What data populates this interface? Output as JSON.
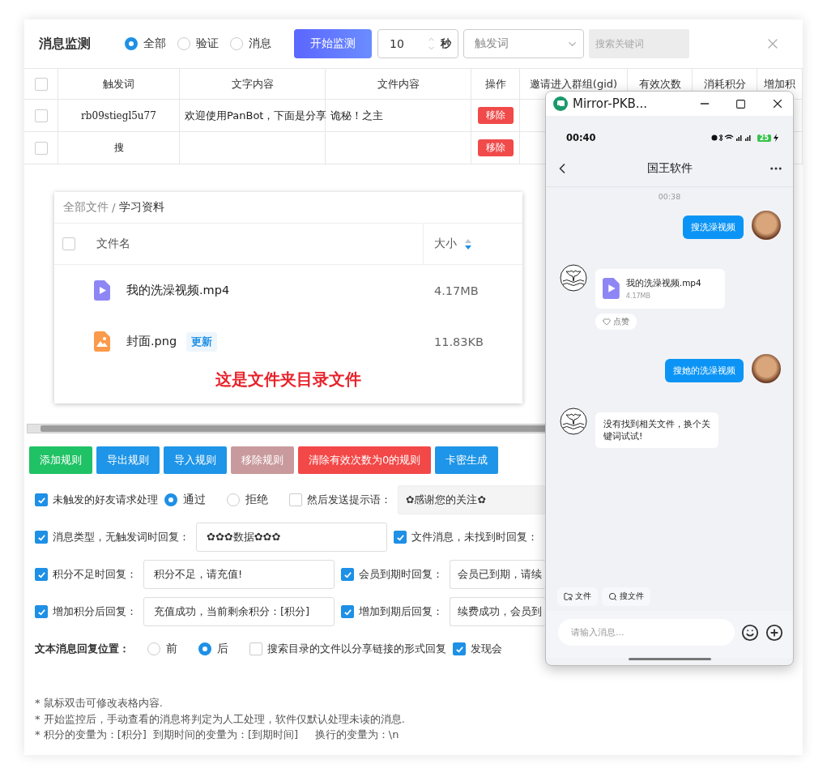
{
  "title": "消息监测",
  "filter": [
    {
      "label": "全部",
      "selected": true
    },
    {
      "label": "验证",
      "selected": false
    },
    {
      "label": "消息",
      "selected": false
    }
  ],
  "start_button": "开始监测",
  "interval": {
    "value": "10",
    "unit": "秒"
  },
  "trigger_select": {
    "placeholder": "触发词"
  },
  "search": {
    "placeholder": "搜索关键词"
  },
  "table": {
    "select_all_checked": false,
    "columns": [
      "触发词",
      "文字内容",
      "文件内容",
      "操作",
      "邀请进入群组(gid)",
      "有效次数",
      "消耗积分",
      "增加积"
    ],
    "rows": [
      {
        "checked": false,
        "trigger": "rb09stiegl5u77",
        "text": "欢迎使用PanBot，下面是分享",
        "file": "诡秘！之主",
        "action": "移除"
      },
      {
        "checked": false,
        "trigger": "搜",
        "action": "移除"
      }
    ]
  },
  "file_panel": {
    "breadcrumb": [
      "全部文件",
      "学习资料"
    ],
    "separator": "/",
    "select_all_checked": false,
    "columns": [
      "文件名",
      "大小"
    ],
    "files": [
      {
        "kind": "video",
        "name": "我的洗澡视频.mp4",
        "size": "4.17MB"
      },
      {
        "kind": "image",
        "name": "封面.png",
        "tag": "更新",
        "size": "11.83KB"
      }
    ],
    "caption": "这是文件夹目录文件"
  },
  "buttons": [
    {
      "label": "添加规则",
      "kind": "success",
      "disabled": false
    },
    {
      "label": "导出规则",
      "kind": "primary",
      "disabled": false
    },
    {
      "label": "导入规则",
      "kind": "primary",
      "disabled": false
    },
    {
      "label": "移除规则",
      "kind": "danger",
      "disabled": true
    },
    {
      "label": "清除有效次数为0的规则",
      "kind": "danger",
      "disabled": false
    },
    {
      "label": "卡密生成",
      "kind": "primary",
      "disabled": false
    }
  ],
  "settings": [
    {
      "items": [
        {
          "kind": "checkbox",
          "label": "未触发的好友请求处理",
          "checked": true
        },
        {
          "kind": "radio",
          "label": "通过",
          "selected": true
        },
        {
          "kind": "radio",
          "label": "拒绝",
          "selected": false
        },
        {
          "kind": "checkbox",
          "label": "然后发送提示语：",
          "checked": false
        },
        {
          "kind": "input",
          "value": "✿感谢您的关注✿",
          "disabled": true
        }
      ]
    },
    {
      "items": [
        {
          "kind": "checkbox",
          "label": "消息类型，无触发词时回复：",
          "checked": true
        },
        {
          "kind": "input",
          "value": "✿✿✿数据✿✿✿",
          "disabled": false
        },
        {
          "kind": "checkbox",
          "label": "文件消息，未找到时回复：",
          "checked": true
        }
      ]
    },
    {
      "items": [
        {
          "kind": "checkbox",
          "label": "积分不足时回复：",
          "checked": true
        },
        {
          "kind": "input",
          "value": "积分不足，请充值!",
          "disabled": false
        },
        {
          "kind": "checkbox",
          "label": "会员到期时回复：",
          "checked": true
        },
        {
          "kind": "input",
          "value": "会员已到期，请续",
          "disabled": false
        }
      ]
    },
    {
      "items": [
        {
          "kind": "checkbox",
          "label": "增加积分后回复：",
          "checked": true
        },
        {
          "kind": "input",
          "value": "充值成功，当前剩余积分：[积分]",
          "disabled": false
        },
        {
          "kind": "checkbox",
          "label": "增加到期后回复：",
          "checked": true
        },
        {
          "kind": "input",
          "value": "续费成功，会员到",
          "disabled": false
        }
      ]
    },
    {
      "items": [
        {
          "kind": "label",
          "label": "文本消息回复位置："
        },
        {
          "kind": "radio",
          "label": "前",
          "selected": false
        },
        {
          "kind": "radio",
          "label": "后",
          "selected": true
        },
        {
          "kind": "checkbox",
          "label": "搜索目录的文件以分享链接的形式回复",
          "checked": false
        },
        {
          "kind": "checkbox",
          "label": "发现会",
          "checked": true
        }
      ]
    }
  ],
  "notes": [
    "* 鼠标双击可修改表格内容.",
    "* 开始监控后，手动查看的消息将判定为人工处理，软件仅默认处理未读的消息.",
    "* 积分的变量为：[积分]  到期时间的变量为：[到期时间]     换行的变量为：\\n"
  ],
  "phone": {
    "window_title": "Mirror-PKB...",
    "time": "00:40",
    "battery": "25",
    "chat_title": "国王软件",
    "timestamp": "00:38",
    "messages": [
      {
        "mine": true,
        "kind": "text",
        "text": "搜洗澡视频"
      },
      {
        "mine": false,
        "kind": "file",
        "name": "我的洗澡视频.mp4",
        "size": "4.17MB",
        "like": "点赞"
      },
      {
        "mine": true,
        "kind": "text",
        "text": "搜她的洗澡视频"
      },
      {
        "mine": false,
        "kind": "text",
        "text": "没有找到相关文件，换个关键词试试!"
      }
    ],
    "quick_actions": [
      {
        "kind": "folder",
        "label": "文件"
      },
      {
        "kind": "search",
        "label": "搜文件"
      }
    ],
    "input": {
      "placeholder": "请输入消息..."
    }
  }
}
